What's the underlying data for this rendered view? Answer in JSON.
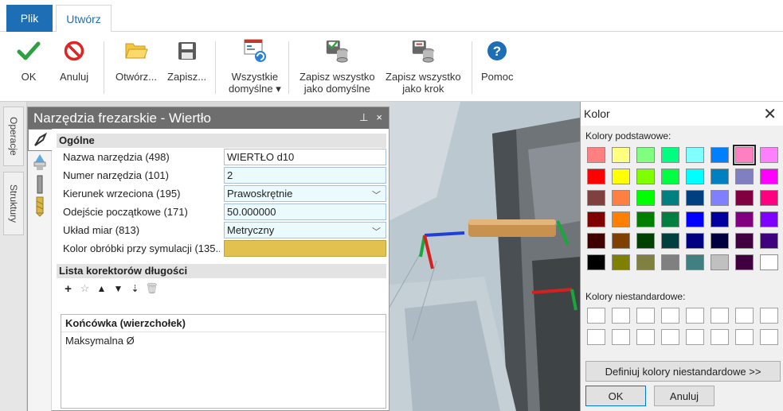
{
  "ribbon_tabs": {
    "file": "Plik",
    "create": "Utwórz"
  },
  "ribbon": {
    "ok": "OK",
    "cancel": "Anuluj",
    "open": "Otwórz...",
    "save": "Zapisz...",
    "all_defaults_l1": "Wszystkie",
    "all_defaults_l2": "domyślne ▾",
    "save_all_default_l1": "Zapisz wszystko",
    "save_all_default_l2": "jako domyślne",
    "save_all_step_l1": "Zapisz wszystko",
    "save_all_step_l2": "jako krok",
    "help": "Pomoc"
  },
  "side_tabs": [
    "Operacje",
    "Struktury"
  ],
  "panel": {
    "title": "Narzędzia frezarskie - Wiertło",
    "pin": "⊥",
    "close": "×",
    "section_general": "Ogólne",
    "properties": [
      {
        "label": "Nazwa narzędzia (498)",
        "value": "WIERTŁO d10"
      },
      {
        "label": "Numer narzędzia (101)",
        "value": "2"
      },
      {
        "label": "Kierunek wrzeciona (195)",
        "value": "Prawoskrętnie"
      },
      {
        "label": "Odejście początkowe (171)",
        "value": "50.000000"
      },
      {
        "label": "Układ miar (813)",
        "value": "Metryczny"
      },
      {
        "label": "Kolor obróbki przy symulacji (135...",
        "value": ""
      }
    ],
    "section_length": "Lista korektorów długości",
    "list_header": "Końcówka (wierzchołek)",
    "list_item": "Maksymalna Ø"
  },
  "color_dialog": {
    "title": "Kolor",
    "close": "✕",
    "basic_label": "Kolory podstawowe:",
    "custom_label": "Kolory niestandardowe:",
    "define_btn": "Definiuj kolory niestandardowe >>",
    "ok": "OK",
    "cancel": "Anuluj",
    "basic_colors": [
      "#ff8080",
      "#ffff80",
      "#80ff80",
      "#00ff80",
      "#80ffff",
      "#0080ff",
      "#ff80c0",
      "#ff80ff",
      "#ff0000",
      "#ffff00",
      "#80ff00",
      "#00ff40",
      "#00ffff",
      "#0080c0",
      "#8080c0",
      "#ff00ff",
      "#804040",
      "#ff8040",
      "#00ff00",
      "#008080",
      "#004080",
      "#8080ff",
      "#800040",
      "#ff0080",
      "#800000",
      "#ff8000",
      "#008000",
      "#008040",
      "#0000ff",
      "#0000a0",
      "#800080",
      "#8000ff",
      "#400000",
      "#804000",
      "#004000",
      "#004040",
      "#000080",
      "#000040",
      "#400040",
      "#400080",
      "#000000",
      "#808000",
      "#808040",
      "#808080",
      "#408080",
      "#c0c0c0",
      "#400040",
      "#ffffff"
    ],
    "selected_index": 6
  },
  "colors": {
    "accent": "#1e6eb5",
    "sim_color": "#e2c14e"
  }
}
